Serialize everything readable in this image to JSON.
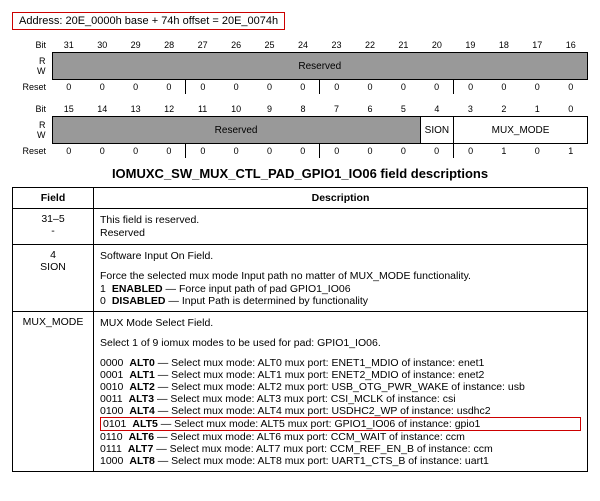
{
  "address_line": "Address: 20E_0000h base + 74h offset = 20E_0074h",
  "upper": {
    "bit_label": "Bit",
    "rw_label_r": "R",
    "rw_label_w": "W",
    "reset_label": "Reset",
    "bits": [
      "31",
      "30",
      "29",
      "28",
      "27",
      "26",
      "25",
      "24",
      "23",
      "22",
      "21",
      "20",
      "19",
      "18",
      "17",
      "16"
    ],
    "rw_text": "Reserved",
    "resets": [
      "0",
      "0",
      "0",
      "0",
      "0",
      "0",
      "0",
      "0",
      "0",
      "0",
      "0",
      "0",
      "0",
      "0",
      "0",
      "0"
    ]
  },
  "lower": {
    "bit_label": "Bit",
    "rw_label_r": "R",
    "rw_label_w": "W",
    "reset_label": "Reset",
    "bits": [
      "15",
      "14",
      "13",
      "12",
      "11",
      "10",
      "9",
      "8",
      "7",
      "6",
      "5",
      "4",
      "3",
      "2",
      "1",
      "0"
    ],
    "rw_reserved": "Reserved",
    "rw_sion": "SION",
    "rw_mux": "MUX_MODE",
    "resets": [
      "0",
      "0",
      "0",
      "0",
      "0",
      "0",
      "0",
      "0",
      "0",
      "0",
      "0",
      "0",
      "0",
      "1",
      "0",
      "1"
    ]
  },
  "section_title": "IOMUXC_SW_MUX_CTL_PAD_GPIO1_IO06 field descriptions",
  "table_headers": {
    "field": "Field",
    "desc": "Description"
  },
  "rows": {
    "r0": {
      "field": "31–5\n-",
      "l1": "This field is reserved.",
      "l2": "Reserved"
    },
    "r1": {
      "field": "4\nSION",
      "l1": "Software Input On Field.",
      "l2": "Force the selected mux mode Input path no matter of MUX_MODE functionality.",
      "opt1_code": "1",
      "opt1_name": "ENABLED",
      "opt1_text": " — Force input path of pad GPIO1_IO06",
      "opt0_code": "0",
      "opt0_name": "DISABLED",
      "opt0_text": " — Input Path is determined by functionality"
    },
    "r2": {
      "field": "MUX_MODE",
      "l1": "MUX Mode Select Field.",
      "l2": "Select 1 of 9 iomux modes to be used for pad: GPIO1_IO06.",
      "alts": [
        {
          "code": "0000",
          "name": "ALT0",
          "text": " — Select mux mode: ALT0 mux port: ENET1_MDIO of instance: enet1",
          "hl": false
        },
        {
          "code": "0001",
          "name": "ALT1",
          "text": " — Select mux mode: ALT1 mux port: ENET2_MDIO of instance: enet2",
          "hl": false
        },
        {
          "code": "0010",
          "name": "ALT2",
          "text": " — Select mux mode: ALT2 mux port: USB_OTG_PWR_WAKE of instance: usb",
          "hl": false
        },
        {
          "code": "0011",
          "name": "ALT3",
          "text": " — Select mux mode: ALT3 mux port: CSI_MCLK of instance: csi",
          "hl": false
        },
        {
          "code": "0100",
          "name": "ALT4",
          "text": " — Select mux mode: ALT4 mux port: USDHC2_WP of instance: usdhc2",
          "hl": false
        },
        {
          "code": "0101",
          "name": "ALT5",
          "text": " — Select mux mode: ALT5 mux port: GPIO1_IO06 of instance: gpio1",
          "hl": true
        },
        {
          "code": "0110",
          "name": "ALT6",
          "text": " — Select mux mode: ALT6 mux port: CCM_WAIT of instance: ccm",
          "hl": false
        },
        {
          "code": "0111",
          "name": "ALT7",
          "text": " — Select mux mode: ALT7 mux port: CCM_REF_EN_B of instance: ccm",
          "hl": false
        },
        {
          "code": "1000",
          "name": "ALT8",
          "text": " — Select mux mode: ALT8 mux port: UART1_CTS_B of instance: uart1",
          "hl": false
        }
      ]
    }
  }
}
